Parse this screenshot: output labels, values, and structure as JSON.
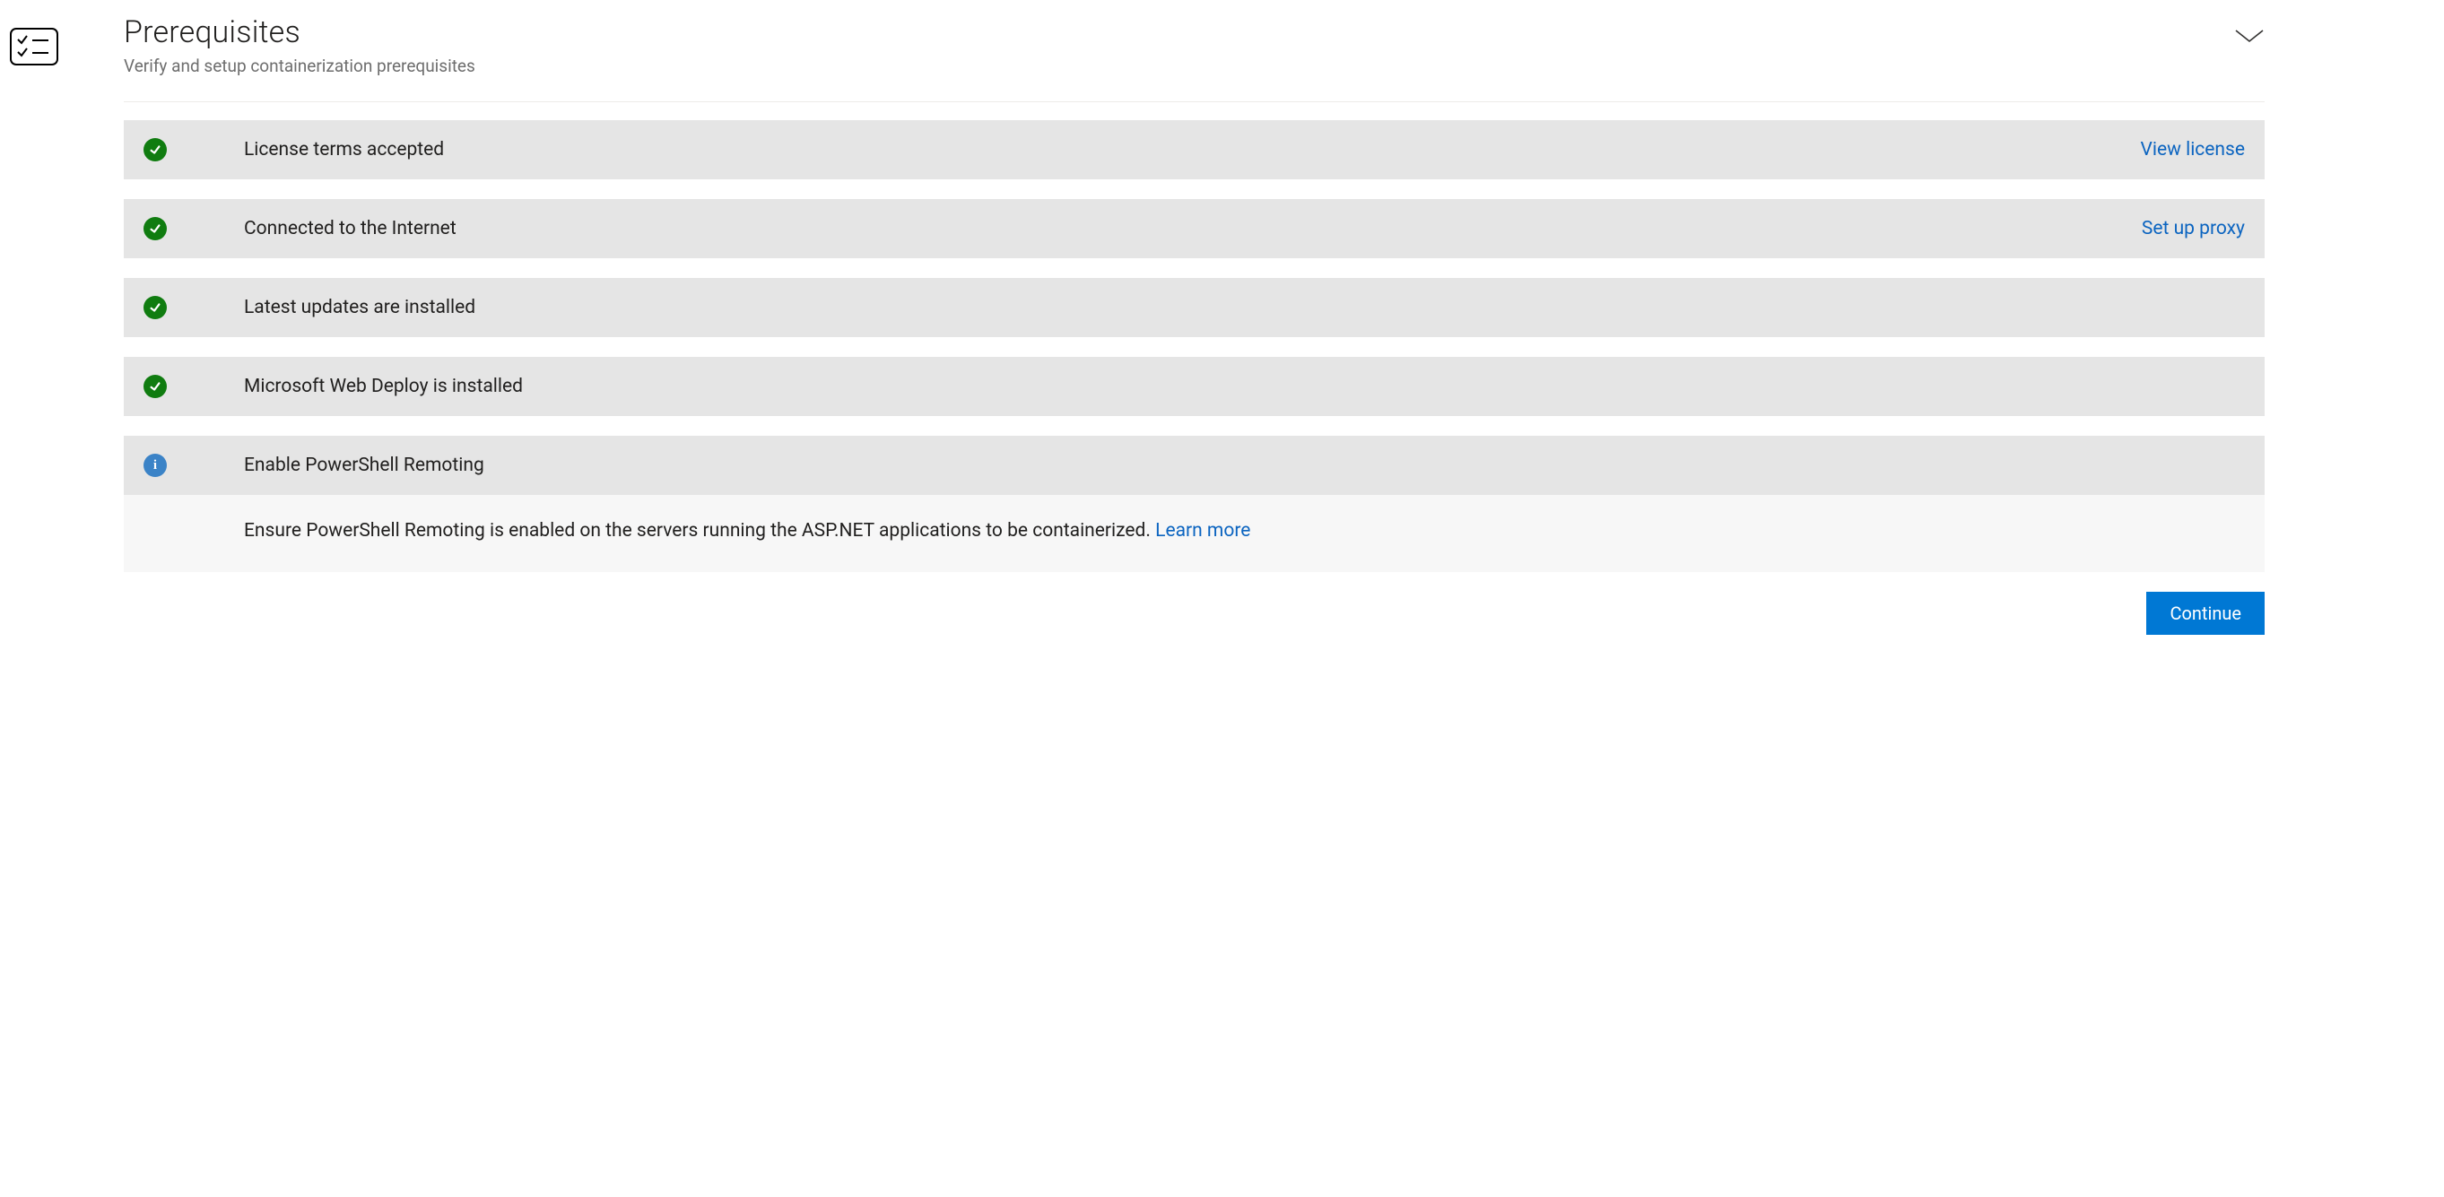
{
  "header": {
    "title": "Prerequisites",
    "subtitle": "Verify and setup containerization prerequisites"
  },
  "items": [
    {
      "status": "success",
      "label": "License terms accepted",
      "action": "View license"
    },
    {
      "status": "success",
      "label": "Connected to the Internet",
      "action": "Set up proxy"
    },
    {
      "status": "success",
      "label": "Latest updates are installed",
      "action": ""
    },
    {
      "status": "success",
      "label": "Microsoft Web Deploy is installed",
      "action": ""
    },
    {
      "status": "info",
      "label": "Enable PowerShell Remoting",
      "action": "",
      "detail": "Ensure PowerShell Remoting is enabled on the servers running the ASP.NET applications to be containerized.",
      "detailLink": "Learn more"
    }
  ],
  "footer": {
    "continue": "Continue"
  }
}
